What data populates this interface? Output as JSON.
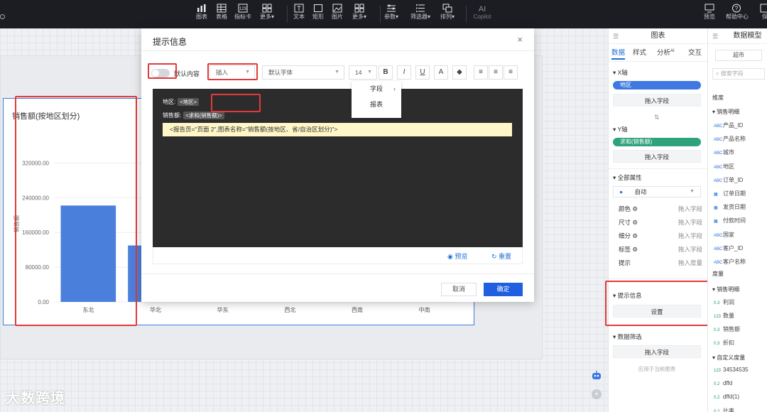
{
  "toolbar": {
    "items": [
      {
        "label": "图表",
        "icon": "bar-chart-icon"
      },
      {
        "label": "表格",
        "icon": "table-icon"
      },
      {
        "label": "指标卡",
        "icon": "kpi-card-icon"
      },
      {
        "label": "更多▾",
        "icon": "grid-more-icon"
      },
      {
        "label": "文本",
        "icon": "text-icon"
      },
      {
        "label": "矩形",
        "icon": "rectangle-icon"
      },
      {
        "label": "图片",
        "icon": "image-icon"
      },
      {
        "label": "更多▾",
        "icon": "grid-more-icon"
      },
      {
        "label": "参数▾",
        "icon": "parameter-icon"
      },
      {
        "label": "筛选器▾",
        "icon": "filter-icon"
      },
      {
        "label": "排列▾",
        "icon": "arrange-icon"
      },
      {
        "label": "Copilot",
        "icon": "ai-icon",
        "glyph": "AI"
      }
    ],
    "right": [
      {
        "label": "预览",
        "icon": "preview-icon"
      },
      {
        "label": "帮助中心",
        "icon": "help-icon"
      },
      {
        "label": "保",
        "icon": "save-icon"
      }
    ]
  },
  "chart_data": {
    "type": "bar",
    "title": "销售额(按地区划分)",
    "ylabel": "销售额",
    "categories": [
      "东北",
      "华北",
      "华东",
      "西北",
      "西南",
      "中南"
    ],
    "values": [
      222000,
      130000,
      null,
      null,
      null,
      null
    ],
    "yticks": [
      "320000.00",
      "240000.00",
      "160000.00",
      "80000.00",
      "0.00"
    ],
    "ylim": [
      0,
      360000
    ],
    "color": "#4a7fdb"
  },
  "modal": {
    "title": "提示信息",
    "close": "×",
    "toggle_label": "默认内容",
    "insert_select": "插入",
    "font_select": "默认字体",
    "size_select": "14",
    "format_buttons": [
      "B",
      "I",
      "U",
      "A",
      "◆"
    ],
    "align_buttons": [
      "≡",
      "≡",
      "≡"
    ],
    "dropdown": {
      "field": "字段",
      "report": "报表"
    },
    "editor": {
      "line1_label": "地区:",
      "line1_tag": "<地区>",
      "line2_label": "销售额:",
      "line2_tag": "<求和(销售额)>",
      "report_line": "<报告页=\"页面 2\",图表名称=\"销售额(按地区、省/自治区划分)\">"
    },
    "preview": "预览",
    "reset": "重置",
    "cancel": "取消",
    "ok": "确定"
  },
  "panel1": {
    "title": "图表",
    "tabs": [
      "数据",
      "样式",
      "分析",
      "交互"
    ],
    "ai_badge": "AI",
    "x_axis": "X轴",
    "x_pill": "地区",
    "drop_field": "拖入字段",
    "y_axis": "Y轴",
    "y_pill": "求和(销售额)",
    "all_props": "全部属性",
    "auto": "自动",
    "props": [
      {
        "name": "颜色",
        "value": "拖入字段"
      },
      {
        "name": "尺寸",
        "value": "拖入字段"
      },
      {
        "name": "细分",
        "value": "拖入字段"
      },
      {
        "name": "标签",
        "value": "拖入字段"
      },
      {
        "name": "提示",
        "value": "拖入度量"
      }
    ],
    "tooltip_section": "提示信息",
    "settings": "设置",
    "data_filter": "数据筛选",
    "drop_field2": "拖入字段",
    "apply_current": "应用于当前图表"
  },
  "panel2": {
    "title": "数据模型",
    "top_box": "超市",
    "search_placeholder": "搜索字段",
    "dimension": "维度",
    "group1": "销售明细",
    "dim_fields": [
      "产品_ID",
      "产品名称",
      "城市",
      "地区",
      "订单_ID",
      "订单日期",
      "发货日期",
      "付款时间",
      "国家",
      "客户_ID",
      "客户名称"
    ],
    "measure": "度量",
    "group2": "销售明细",
    "measure_fields": [
      "利润",
      "数量",
      "销售额",
      "折扣"
    ],
    "custom_group": "自定义度量",
    "custom_fields": [
      "34534535",
      "dffd",
      "dffd(1)",
      "比率"
    ]
  },
  "watermark": "大数跨境"
}
